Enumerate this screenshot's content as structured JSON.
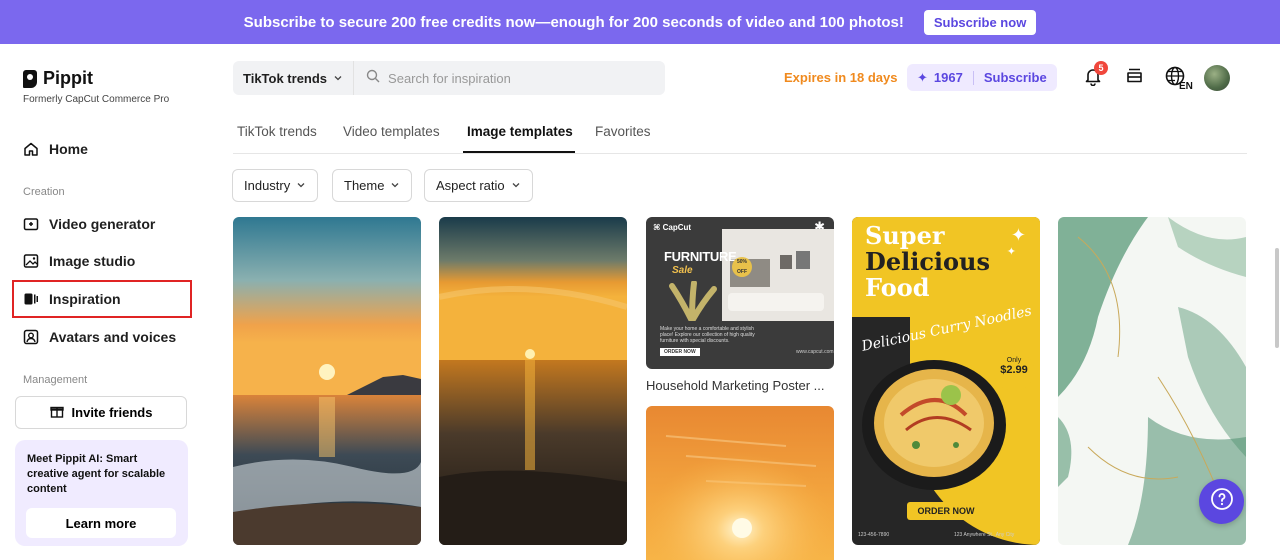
{
  "banner": {
    "text": "Subscribe to secure 200 free credits now—enough for 200 seconds of video and 100 photos!",
    "button": "Subscribe now"
  },
  "brand": {
    "name": "Pippit",
    "subtitle": "Formerly CapCut Commerce Pro"
  },
  "sidebar": {
    "home": "Home",
    "creation_label": "Creation",
    "items": [
      {
        "label": "Video generator",
        "icon": "video-plus-icon"
      },
      {
        "label": "Image studio",
        "icon": "image-plus-icon"
      },
      {
        "label": "Inspiration",
        "icon": "inspiration-icon",
        "active": true
      },
      {
        "label": "Avatars and voices",
        "icon": "avatar-icon"
      }
    ],
    "management_label": "Management",
    "invite": "Invite friends",
    "promo": {
      "title": "Meet Pippit AI:",
      "text": "Smart creative agent for scalable content",
      "button": "Learn more"
    }
  },
  "topbar": {
    "dropdown": "TikTok trends",
    "search_placeholder": "Search for inspiration",
    "expires": "Expires in 18 days",
    "credits": "1967",
    "subscribe": "Subscribe",
    "notifications": "5",
    "language": "EN"
  },
  "tabs": [
    "TikTok trends",
    "Video templates",
    "Image templates",
    "Favorites"
  ],
  "active_tab": "Image templates",
  "filters": [
    "Industry",
    "Theme",
    "Aspect ratio"
  ],
  "cards": {
    "furniture": {
      "brand": "CapCut",
      "title": "FURNITURE",
      "tag": "Sale",
      "discount": "50% OFF",
      "body": "Make your home a comfortable and stylish place! Explore our collection of high quality furniture with special discounts.",
      "cta": "ORDER NOW",
      "site": "www.capcut.com",
      "caption": "Household Marketing Poster ..."
    },
    "food": {
      "line1": "Super",
      "line2": "Delicious",
      "line3": "Food",
      "arc": "Delicious Curry Noodles",
      "price_label": "Only",
      "price": "$2.99",
      "cta": "ORDER NOW",
      "phone": "123-456-7890",
      "address": "123 Anywhere St., Any City"
    }
  },
  "colors": {
    "accent": "#5b47e0",
    "banner": "#7b68ee",
    "warning": "#f08a1e",
    "highlight": "#e02424"
  }
}
